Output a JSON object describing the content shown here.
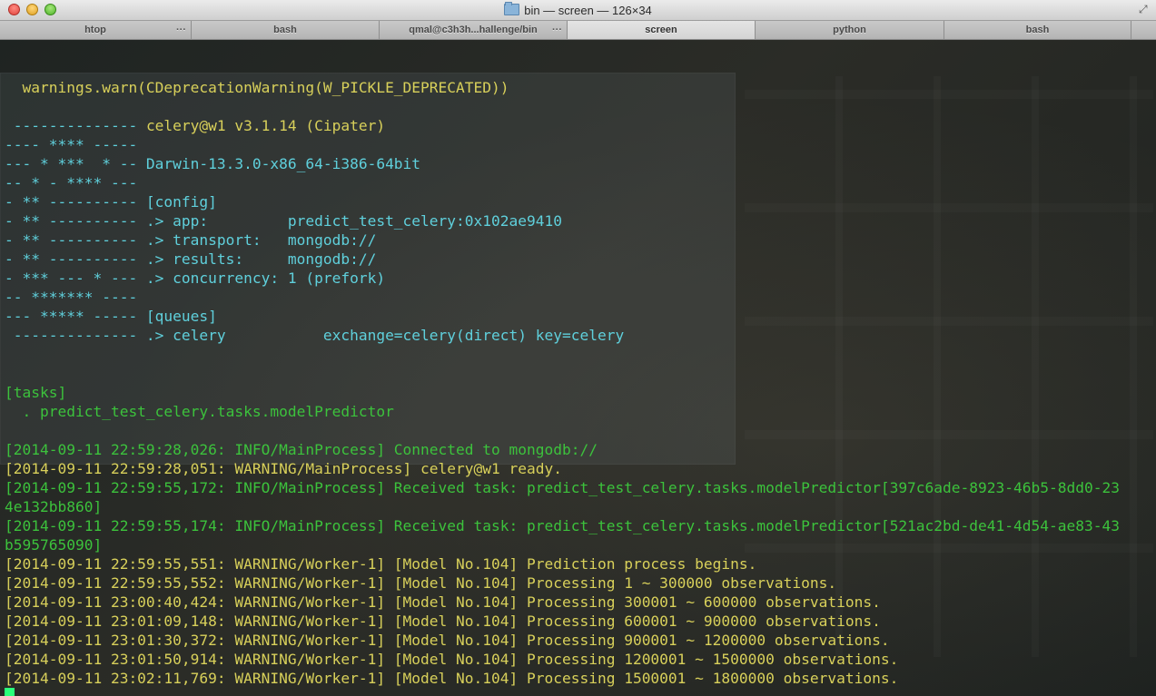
{
  "window": {
    "title": "bin — screen — 126×34",
    "icons": {
      "close": "close-traffic-light",
      "minimize": "minimize-traffic-light",
      "zoom": "zoom-traffic-light",
      "folder": "folder-icon",
      "fullscreen": "fullscreen-icon"
    },
    "fullscreen_glyph": "⤢"
  },
  "tabs": [
    {
      "label": "htop",
      "dots": "···",
      "active": false
    },
    {
      "label": "bash",
      "dots": "",
      "active": false
    },
    {
      "label": "qmal@c3h3h...hallenge/bin",
      "dots": "···",
      "active": false
    },
    {
      "label": "screen",
      "dots": "",
      "active": true
    },
    {
      "label": "python",
      "dots": "",
      "active": false
    },
    {
      "label": "bash",
      "dots": "",
      "active": false
    }
  ],
  "colors": {
    "yellow": "#d8d05a",
    "cyan": "#5fd0dc",
    "white": "#d8d8d8",
    "green": "#3cc23c",
    "cursor": "#2bff7a"
  },
  "terminal": {
    "lines": [
      [
        {
          "text": "",
          "c": "white"
        }
      ],
      [
        {
          "text": "  warnings.warn(CDeprecationWarning(W_PICKLE_DEPRECATED))",
          "c": "yellow"
        }
      ],
      [
        {
          "text": "",
          "c": "white"
        }
      ],
      [
        {
          "text": " -------------- ",
          "c": "cyan"
        },
        {
          "text": "celery@w1 v3.1.14 (Cipater)",
          "c": "yellow"
        }
      ],
      [
        {
          "text": "---- **** ----- ",
          "c": "cyan"
        }
      ],
      [
        {
          "text": "--- * ***  * -- Darwin-13.3.0-x86_64-i386-64bit",
          "c": "cyan"
        }
      ],
      [
        {
          "text": "-- * - **** --- ",
          "c": "cyan"
        }
      ],
      [
        {
          "text": "- ** ---------- [config]",
          "c": "cyan"
        }
      ],
      [
        {
          "text": "- ** ---------- .> app:         predict_test_celery:0x102ae9410",
          "c": "cyan"
        }
      ],
      [
        {
          "text": "- ** ---------- .> transport:   mongodb://",
          "c": "cyan"
        }
      ],
      [
        {
          "text": "- ** ---------- .> results:     mongodb://",
          "c": "cyan"
        }
      ],
      [
        {
          "text": "- *** --- * --- .> concurrency: 1 (prefork)",
          "c": "cyan"
        }
      ],
      [
        {
          "text": "-- ******* ---- ",
          "c": "cyan"
        }
      ],
      [
        {
          "text": "--- ***** ----- [queues]",
          "c": "cyan"
        }
      ],
      [
        {
          "text": " -------------- .> celery           exchange=celery(direct) key=celery",
          "c": "cyan"
        }
      ],
      [
        {
          "text": "",
          "c": "white"
        }
      ],
      [
        {
          "text": "",
          "c": "white"
        }
      ],
      [
        {
          "text": "[tasks]",
          "c": "green"
        }
      ],
      [
        {
          "text": "  . predict_test_celery.tasks.modelPredictor",
          "c": "green"
        }
      ],
      [
        {
          "text": "",
          "c": "white"
        }
      ],
      [
        {
          "text": "[2014-09-11 22:59:28,026: INFO/MainProcess] Connected to mongodb://",
          "c": "green"
        }
      ],
      [
        {
          "text": "[2014-09-11 22:59:28,051: WARNING/MainProcess] celery@w1 ready.",
          "c": "yellow"
        }
      ],
      [
        {
          "text": "[2014-09-11 22:59:55,172: INFO/MainProcess] Received task: predict_test_celery.tasks.modelPredictor[397c6ade-8923-46b5-8dd0-23",
          "c": "green"
        }
      ],
      [
        {
          "text": "4e132bb860]",
          "c": "green"
        }
      ],
      [
        {
          "text": "[2014-09-11 22:59:55,174: INFO/MainProcess] Received task: predict_test_celery.tasks.modelPredictor[521ac2bd-de41-4d54-ae83-43",
          "c": "green"
        }
      ],
      [
        {
          "text": "b595765090]",
          "c": "green"
        }
      ],
      [
        {
          "text": "[2014-09-11 22:59:55,551: WARNING/Worker-1] [Model No.104] Prediction process begins.",
          "c": "yellow"
        }
      ],
      [
        {
          "text": "[2014-09-11 22:59:55,552: WARNING/Worker-1] [Model No.104] Processing 1 ~ 300000 observations.",
          "c": "yellow"
        }
      ],
      [
        {
          "text": "[2014-09-11 23:00:40,424: WARNING/Worker-1] [Model No.104] Processing 300001 ~ 600000 observations.",
          "c": "yellow"
        }
      ],
      [
        {
          "text": "[2014-09-11 23:01:09,148: WARNING/Worker-1] [Model No.104] Processing 600001 ~ 900000 observations.",
          "c": "yellow"
        }
      ],
      [
        {
          "text": "[2014-09-11 23:01:30,372: WARNING/Worker-1] [Model No.104] Processing 900001 ~ 1200000 observations.",
          "c": "yellow"
        }
      ],
      [
        {
          "text": "[2014-09-11 23:01:50,914: WARNING/Worker-1] [Model No.104] Processing 1200001 ~ 1500000 observations.",
          "c": "yellow"
        }
      ],
      [
        {
          "text": "[2014-09-11 23:02:11,769: WARNING/Worker-1] [Model No.104] Processing 1500001 ~ 1800000 observations.",
          "c": "yellow"
        }
      ]
    ],
    "cursor": "block-cursor"
  }
}
